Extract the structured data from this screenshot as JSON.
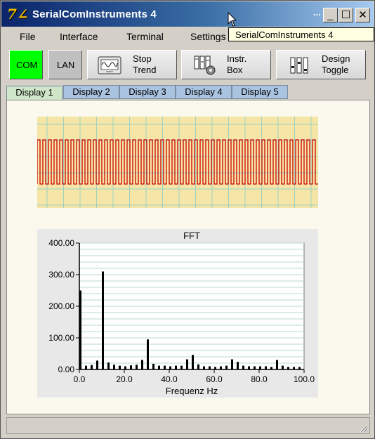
{
  "window": {
    "title": "SerialComInstruments  4",
    "dots": "..."
  },
  "titlebar_buttons": {
    "minimize": "_",
    "maximize": "☐",
    "close": "✕"
  },
  "tooltip": "SerialComInstruments  4",
  "menu": [
    "File",
    "Interface",
    "Terminal",
    "Settings"
  ],
  "toolbar": {
    "com": "COM",
    "lan": "LAN",
    "stop_trend": [
      "Stop",
      "Trend"
    ],
    "instr_box": [
      "Instr.",
      "Box"
    ],
    "design_toggle": [
      "Design",
      "Toggle"
    ],
    "colors": {
      "com_bg": "#00ff00",
      "lan_bg": "#c0c0c0"
    }
  },
  "tabs": [
    "Display 1",
    "Display 2",
    "Display 3",
    "Display 4",
    "Display 5"
  ],
  "active_tab": 0,
  "chart_data": [
    {
      "type": "line",
      "title": "",
      "description": "square wave trend",
      "cycles": 50,
      "line_color": "#cc0000",
      "background": "#f5e6a8",
      "grid": true
    },
    {
      "type": "bar",
      "title": "FFT",
      "xlabel": "Frequenz Hz",
      "ylabel": "",
      "xlim": [
        0,
        100
      ],
      "ylim": [
        0,
        400
      ],
      "xticks": [
        "0.0",
        "20.0",
        "40.0",
        "60.0",
        "80.0",
        "100.0"
      ],
      "yticks": [
        "0.00",
        "100.00",
        "200.00",
        "300.00",
        "400.00"
      ],
      "x": [
        0,
        2.5,
        5,
        7.5,
        10,
        12.5,
        15,
        17.5,
        20,
        22.5,
        25,
        27.5,
        30,
        32.5,
        35,
        37.5,
        40,
        42.5,
        45,
        47.5,
        50,
        52.5,
        55,
        57.5,
        60,
        62.5,
        65,
        67.5,
        70,
        72.5,
        75,
        77.5,
        80,
        82.5,
        85,
        87.5,
        90,
        92.5,
        95,
        97.5
      ],
      "values": [
        250,
        12,
        14,
        28,
        310,
        22,
        15,
        12,
        10,
        13,
        15,
        30,
        95,
        18,
        12,
        12,
        10,
        12,
        12,
        32,
        46,
        16,
        10,
        10,
        8,
        10,
        12,
        32,
        24,
        12,
        10,
        10,
        10,
        10,
        8,
        30,
        12,
        8,
        8,
        8
      ],
      "grid": true,
      "bar_color": "#000000"
    }
  ]
}
